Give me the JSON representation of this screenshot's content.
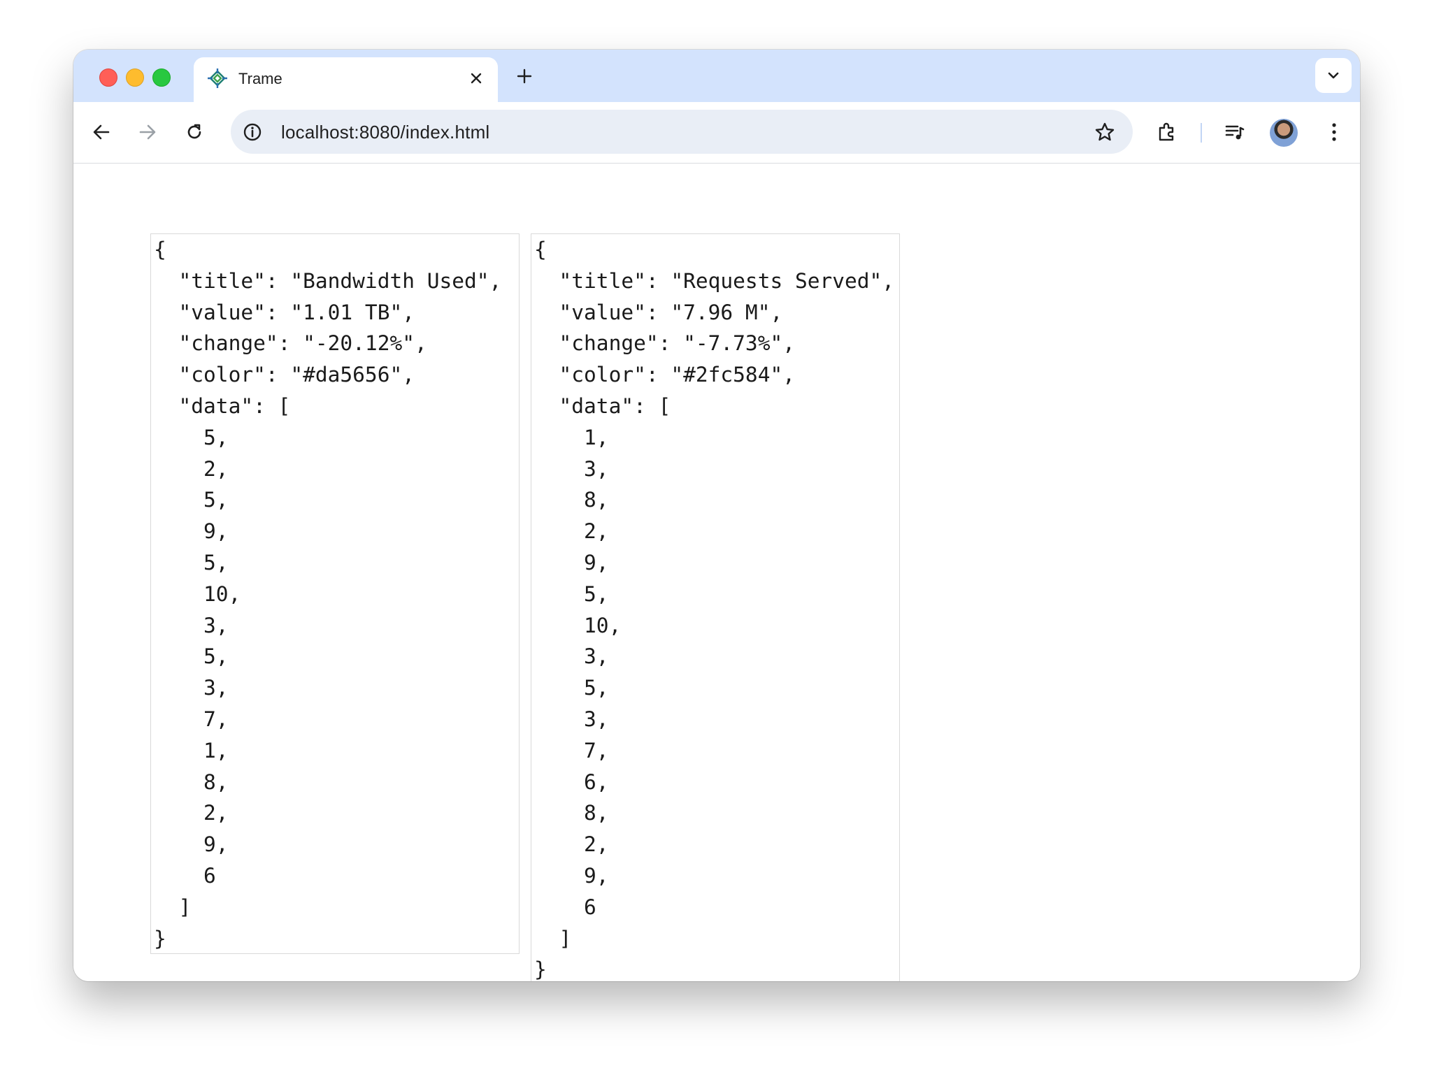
{
  "browser": {
    "tab_title": "Trame",
    "url": "localhost:8080/index.html",
    "icons": {
      "tab_favicon": "trame-logo-icon",
      "tab_close": "close-icon",
      "new_tab": "plus-icon",
      "tab_search": "chevron-down-icon",
      "back": "arrow-left-icon",
      "forward": "arrow-right-icon",
      "reload": "reload-icon",
      "site_info": "info-icon",
      "bookmark": "star-icon",
      "extensions": "puzzle-icon",
      "media": "media-control-icon",
      "profile": "avatar",
      "menu": "kebab-menu-icon"
    }
  },
  "cards": [
    {
      "text": "{\n  \"title\": \"Bandwidth Used\",\n  \"value\": \"1.01 TB\",\n  \"change\": \"-20.12%\",\n  \"color\": \"#da5656\",\n  \"data\": [\n    5,\n    2,\n    5,\n    9,\n    5,\n    10,\n    3,\n    5,\n    3,\n    7,\n    1,\n    8,\n    2,\n    9,\n    6\n  ]\n}"
    },
    {
      "text": "{\n  \"title\": \"Requests Served\",\n  \"value\": \"7.96 M\",\n  \"change\": \"-7.73%\",\n  \"color\": \"#2fc584\",\n  \"data\": [\n    1,\n    3,\n    8,\n    2,\n    9,\n    5,\n    10,\n    3,\n    5,\n    3,\n    7,\n    6,\n    8,\n    2,\n    9,\n    6\n  ]\n}"
    }
  ]
}
